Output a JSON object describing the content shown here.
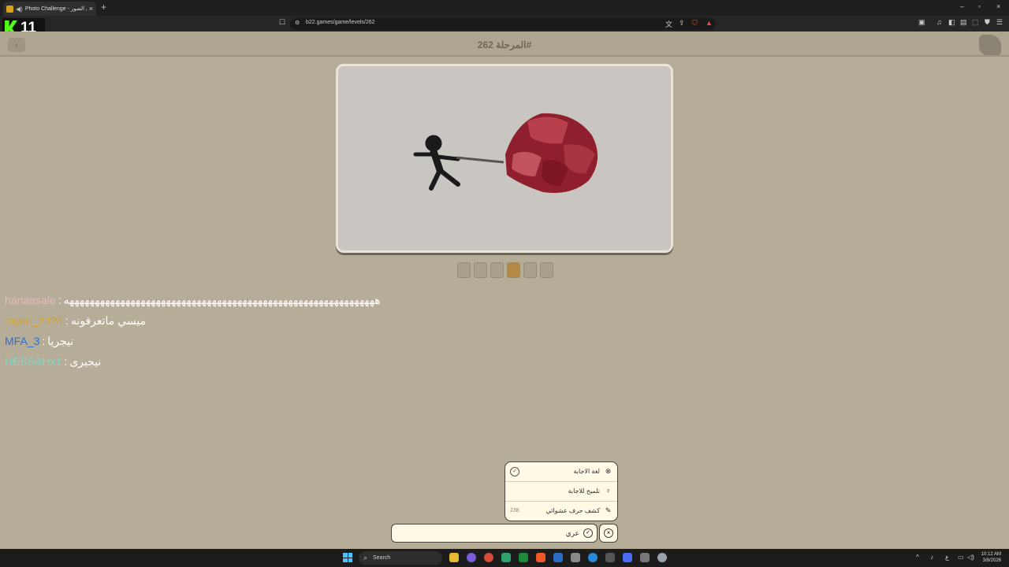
{
  "browser": {
    "tab_title": "Photo Challenge - تحدي الصور",
    "new_tab": "+",
    "close_tab": "×",
    "url": "b22.games/game/levels/262",
    "window_controls": [
      "–",
      "▫",
      "×"
    ]
  },
  "stream_badge": {
    "number": "11"
  },
  "page": {
    "back_symbol": "‹",
    "level_title": "المرحلة 262#"
  },
  "letter_slots": {
    "count": 6,
    "active_index": 3
  },
  "chat": [
    {
      "user": "hanaasale",
      "color": "#e8b8c0",
      "separator": ":",
      "text": "هههههههههههههههههههههههههههههههههههههههههههههههههههههههههههههه"
    },
    {
      "user": "rayan_2424",
      "color": "#d9a32a",
      "separator": ":",
      "text": "ميسي ماتعرفونه"
    },
    {
      "user": "MFA_3",
      "color": "#2a6fd6",
      "separator": ":",
      "text": "نيجريا"
    },
    {
      "user": "HESSAHx1",
      "color": "#7fd6c9",
      "separator": ":",
      "text": "نيجيرى"
    }
  ],
  "hints": [
    {
      "label": "لغة الاجابة",
      "icon": "globe-icon",
      "cost": ""
    },
    {
      "label": "تلميح للاجابة",
      "icon": "lightbulb-icon",
      "cost": ""
    },
    {
      "label": "كشف حرف عشوائي",
      "icon": "pencil-icon",
      "cost": "238"
    }
  ],
  "answer": {
    "value": "عري"
  },
  "taskbar": {
    "search_label": "Search",
    "time": "10:12 AM",
    "date": "3/8/2026",
    "lang": "ع"
  },
  "colors": {
    "background": "#b5ad98",
    "card_bg": "#fff9e6",
    "accent": "#b38a45"
  }
}
